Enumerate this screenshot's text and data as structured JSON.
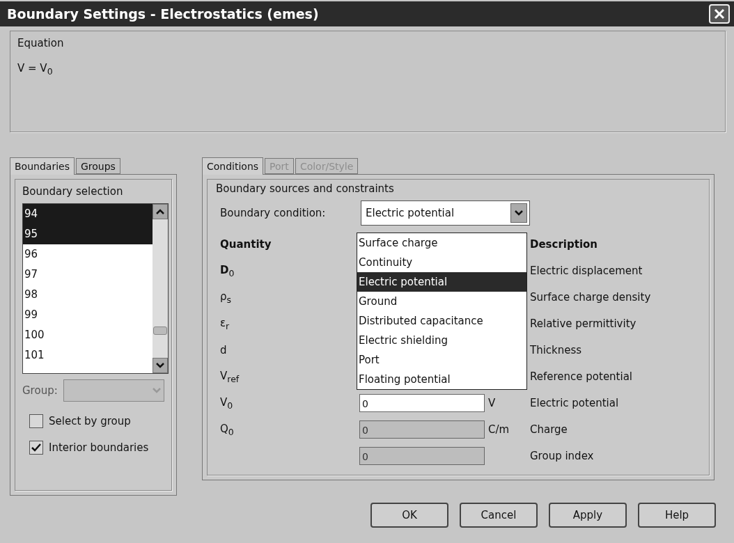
{
  "window": {
    "title": "Boundary Settings - Electrostatics (emes)"
  },
  "equation": {
    "label": "Equation",
    "formula": "V = V$_{0}$"
  },
  "left_tabs": [
    {
      "label": "Boundaries",
      "selected": true
    },
    {
      "label": "Groups",
      "selected": false
    }
  ],
  "boundary_selection": {
    "title": "Boundary selection",
    "items": [
      {
        "label": "94",
        "selected": true
      },
      {
        "label": "95",
        "selected": true
      },
      {
        "label": "96",
        "selected": false
      },
      {
        "label": "97",
        "selected": false
      },
      {
        "label": "98",
        "selected": false
      },
      {
        "label": "99",
        "selected": false
      },
      {
        "label": "100",
        "selected": false
      },
      {
        "label": "101",
        "selected": false
      }
    ]
  },
  "group": {
    "label": "Group:",
    "disabled": true
  },
  "checkboxes": [
    {
      "label": "Select by group",
      "checked": false
    },
    {
      "label": "Interior boundaries",
      "checked": true
    }
  ],
  "right_tabs": [
    {
      "label": "Conditions",
      "selected": true,
      "disabled": false
    },
    {
      "label": "Port",
      "selected": false,
      "disabled": true
    },
    {
      "label": "Color/Style",
      "selected": false,
      "disabled": true
    }
  ],
  "sources": {
    "title": "Boundary sources and constraints",
    "condition_label": "Boundary condition:",
    "condition_value": "Electric potential",
    "options": [
      {
        "label": "Surface charge",
        "selected": false
      },
      {
        "label": "Continuity",
        "selected": false
      },
      {
        "label": "Electric potential",
        "selected": true
      },
      {
        "label": "Ground",
        "selected": false
      },
      {
        "label": "Distributed capacitance",
        "selected": false
      },
      {
        "label": "Electric shielding",
        "selected": false
      },
      {
        "label": "Port",
        "selected": false
      },
      {
        "label": "Floating potential",
        "selected": false
      }
    ],
    "columns": {
      "quantity": "Quantity",
      "description": "Description"
    },
    "rows": [
      {
        "quantity": "**D**$_{0}$",
        "description": "Electric displacement"
      },
      {
        "quantity": "ρ$_{s}$",
        "description": "Surface charge density"
      },
      {
        "quantity": "ε$_{r}$",
        "description": "Relative permittivity"
      },
      {
        "quantity": "d",
        "description": "Thickness"
      },
      {
        "quantity": "V$_{ref}$",
        "description": "Reference potential"
      },
      {
        "quantity": "V$_{0}$",
        "value": "0",
        "unit": "V",
        "disabled": false,
        "description": "Electric potential"
      },
      {
        "quantity": "Q$_{0}$",
        "value": "0",
        "unit": "C/m",
        "disabled": true,
        "description": "Charge"
      },
      {
        "value": "0",
        "disabled": true,
        "description": "Group index"
      }
    ]
  },
  "buttons": [
    "OK",
    "Cancel",
    "Apply",
    "Help"
  ]
}
